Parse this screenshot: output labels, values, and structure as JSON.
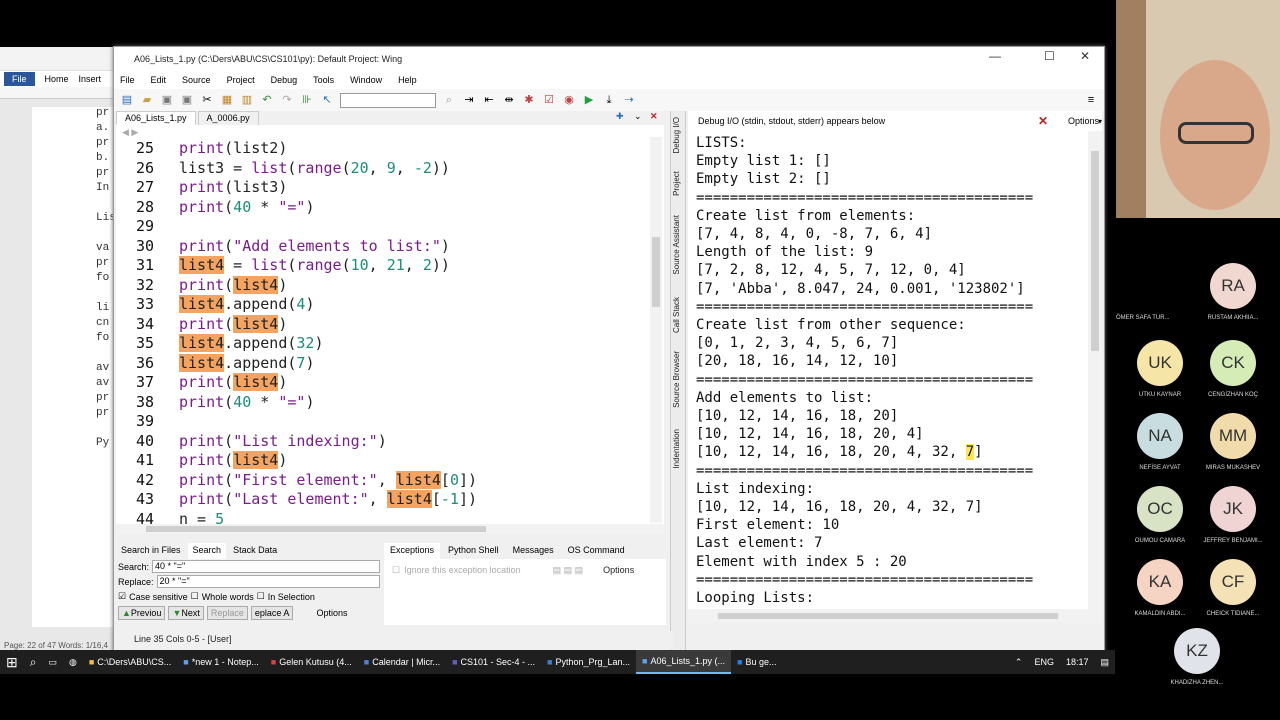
{
  "word": {
    "home_tab": "Home",
    "insert_tab": "Insert",
    "file_tab": "File",
    "doc_lines": [
      "pr",
      "a.",
      "pr",
      "b.",
      "pr",
      "In",
      "",
      "Lis",
      "",
      "va",
      "pr",
      "fo",
      "",
      "li",
      "cn",
      "fo",
      "",
      "av",
      "av",
      "pr",
      "pr",
      "",
      "Py"
    ],
    "status_page": "Page: 22 of 47",
    "status_words": "Words: 1/16,4"
  },
  "wing": {
    "title": "A06_Lists_1.py (C:\\Ders\\ABU\\CS\\CS101\\py): Default Project: Wing",
    "menu": [
      "File",
      "Edit",
      "Source",
      "Project",
      "Debug",
      "Tools",
      "Window",
      "Help"
    ],
    "editor_tabs": [
      "A06_Lists_1.py",
      "A_0006.py"
    ],
    "code": [
      {
        "n": "25",
        "t": "print(list2)"
      },
      {
        "n": "26",
        "t": "list3 = list(range(20, 9, -2))"
      },
      {
        "n": "27",
        "t": "print(list3)"
      },
      {
        "n": "28",
        "t": "print(40 * \"=\")"
      },
      {
        "n": "29",
        "t": ""
      },
      {
        "n": "30",
        "t": "print(\"Add elements to list:\")"
      },
      {
        "n": "31",
        "t": "list4 = list(range(10, 21, 2))"
      },
      {
        "n": "32",
        "t": "print(list4)"
      },
      {
        "n": "33",
        "t": "list4.append(4)"
      },
      {
        "n": "34",
        "t": "print(list4)"
      },
      {
        "n": "35",
        "t": "list4.append(32)"
      },
      {
        "n": "36",
        "t": "list4.append(7)"
      },
      {
        "n": "37",
        "t": "print(list4)"
      },
      {
        "n": "38",
        "t": "print(40 * \"=\")"
      },
      {
        "n": "39",
        "t": ""
      },
      {
        "n": "40",
        "t": "print(\"List indexing:\")"
      },
      {
        "n": "41",
        "t": "print(list4)"
      },
      {
        "n": "42",
        "t": "print(\"First element:\", list4[0])"
      },
      {
        "n": "43",
        "t": "print(\"Last element:\", list4[-1])"
      },
      {
        "n": "44",
        "t": "n = 5"
      }
    ],
    "debug_header": "Debug I/O (stdin, stdout, stderr) appears below",
    "options_label": "Options",
    "output": [
      "LISTS:",
      "Empty list 1: []",
      "Empty list 2: []",
      "========================================",
      "Create list from elements:",
      "[7, 4, 8, 4, 0, -8, 7, 6, 4]",
      "Length of the list: 9",
      "[7, 2, 8, 12, 4, 5, 7, 12, 0, 4]",
      "[7, 'Abba', 8.047, 24, 0.001, '123802']",
      "========================================",
      "Create list from other sequence:",
      "[0, 1, 2, 3, 4, 5, 6, 7]",
      "[20, 18, 16, 14, 12, 10]",
      "========================================",
      "Add elements to list:",
      "[10, 12, 14, 16, 18, 20]",
      "[10, 12, 14, 16, 18, 20, 4]",
      "[10, 12, 14, 16, 18, 20, 4, 32, 7]",
      "========================================",
      "List indexing:",
      "[10, 12, 14, 16, 18, 20, 4, 32, 7]",
      "First element: 10",
      "Last element: 7",
      "Element with index 5 : 20",
      "========================================",
      "Looping Lists:"
    ],
    "side_tabs": [
      "Debug I/O",
      "Project",
      "Source Assistant",
      "Call Stack",
      "Source Browser",
      "Indentation"
    ],
    "search_panel": {
      "tabs": [
        "Search in Files",
        "Search",
        "Stack Data"
      ],
      "search_label": "Search:",
      "search_value": "40 * \"=\"",
      "replace_label": "Replace:",
      "replace_value": "20 * \"=\"",
      "case_sensitive": "Case sensitive",
      "whole_words": "Whole words",
      "in_selection": "In Selection",
      "previous": "Previou",
      "next": "Next",
      "replace": "Replace",
      "replace_all": "eplace A",
      "options": "Options"
    },
    "exception_panel": {
      "tabs": [
        "Exceptions",
        "Python Shell",
        "Messages",
        "OS Command"
      ],
      "ignore_label": "Ignore this exception location",
      "options": "Options"
    },
    "status": "Line 35 Cols 0-5 - [User]"
  },
  "taskbar": {
    "items": [
      "C:\\Ders\\ABU\\CS...",
      "*new 1 - Notep...",
      "Gelen Kutusu (4...",
      "Calendar | Micr...",
      "CS101 - Sec-4 - ...",
      "Python_Prg_Lan...",
      "A06_Lists_1.py (...",
      "Bu ge..."
    ],
    "lang": "ENG",
    "time": "18:17"
  },
  "participants": [
    {
      "initials": "RA",
      "name": "ÖMER SAFA TUR...",
      "name2": "RUSTAM AKHIIA..."
    },
    {
      "initials": "UK",
      "name": "UTKU KAYNAR",
      "color": "#f5e6a8"
    },
    {
      "initials": "CK",
      "name": "CENGİZHAN KOÇ",
      "color": "#d6ecb6"
    },
    {
      "initials": "NA",
      "name": "NEFİSE AYVAT",
      "color": "#c7dde0"
    },
    {
      "initials": "MM",
      "name": "MIRAS MUKASHEV",
      "color": "#f0dcaa"
    },
    {
      "initials": "OC",
      "name": "OUMOU CAMARA",
      "color": "#d8e2c4"
    },
    {
      "initials": "JK",
      "name": "JEFFREY BENJAMI...",
      "color": "#f0d4d4"
    },
    {
      "initials": "KA",
      "name": "KAMALDIN ABDI...",
      "color": "#f6d4c4"
    },
    {
      "initials": "CF",
      "name": "CHEICK TIDIANE...",
      "color": "#f4e2b6"
    },
    {
      "initials": "KZ",
      "name": "KHADIZHA ZHEN...",
      "color": "#e0e4ea"
    }
  ]
}
